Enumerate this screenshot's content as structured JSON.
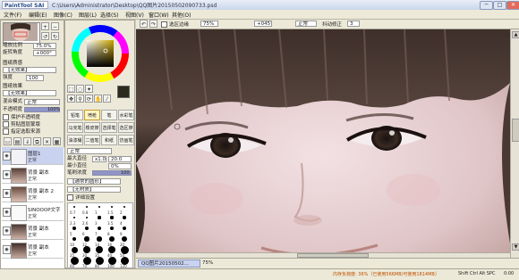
{
  "window": {
    "logo_text": "PaintTool SAI",
    "title": "C:\\Users\\Administrator\\Desktop\\QQ图片20150502090733.psd",
    "buttons": [
      "─",
      "□",
      "✕"
    ]
  },
  "menu": [
    "文件(F)",
    "编辑(E)",
    "图像(C)",
    "图层(L)",
    "选择(S)",
    "视图(V)",
    "窗口(W)",
    "其他(O)"
  ],
  "navigator": {
    "zoom_label": "缩放比例",
    "zoom_value": "75.0%",
    "angle_label": "旋转角度",
    "angle_value": "+000°"
  },
  "layer_props": {
    "effect_header": "图纸质感",
    "effect_value": "【无效果】",
    "strength_label": "强度",
    "strength_value": "100",
    "effect2_header": "图纸效果",
    "effect2_value": "【无效果】",
    "blend_label": "混合模式",
    "blend_value": "正常",
    "opacity_label": "不透明度",
    "opacity_value": "100%",
    "opacity_level": 1.0,
    "checks": [
      "保护不透明度",
      "剪贴图层蒙版",
      "指定选取来源"
    ]
  },
  "layers": [
    {
      "name": "图层1",
      "mode": "正常",
      "opacity": "100%",
      "selected": true
    },
    {
      "name": "背景 副本",
      "mode": "正常",
      "opacity": "100%",
      "selected": false
    },
    {
      "name": "背景 副本 2",
      "mode": "正常",
      "opacity": "100%",
      "selected": false
    },
    {
      "name": "SINOOOP文字",
      "mode": "正常",
      "opacity": "100%",
      "selected": false
    },
    {
      "name": "背景 副本",
      "mode": "正常",
      "opacity": "100%",
      "selected": false
    },
    {
      "name": "背景 副本",
      "mode": "正常",
      "opacity": "100%",
      "selected": false
    }
  ],
  "canvas_toolbar": {
    "antialias_label": "选区边缘",
    "antialias_value": "75%",
    "angle_value": "+045°",
    "mode_value": "正常",
    "stabilizer_label": "抖动修正",
    "stabilizer_value": "3"
  },
  "brushes": {
    "rows": [
      [
        "铅笔",
        "喷枪",
        "笔",
        "水彩笔"
      ],
      [
        "马克笔",
        "橡皮擦",
        "选择笔",
        "选区擦"
      ],
      [
        "油漆桶",
        "二值笔",
        "和纸",
        "仿画笔"
      ]
    ],
    "selected": "喷枪",
    "mode_value": "正常",
    "size_label": "最大直径",
    "size_multiplier": "x1.0",
    "size_value": "20.0",
    "min_size_label": "最小直径",
    "min_size_value": "0%",
    "density_label": "笔刷浓度",
    "density_value": "100",
    "density_level": 1.0,
    "shape_value": "【通常的圆形】",
    "texture_value": "【无材质】",
    "detail_label": "详细设置",
    "sizes": [
      "0.7",
      "0.8",
      "1",
      "1.5",
      "2",
      "2.3",
      "2.6",
      "3",
      "3.5",
      "4",
      "5",
      "6",
      "7",
      "8",
      "9",
      "10",
      "12",
      "14",
      "16",
      "20",
      "25",
      "30",
      "35",
      "40",
      "50",
      "60",
      "70",
      "80",
      "100",
      "120"
    ]
  },
  "canvas": {
    "tab_label": "QQ图片20150502...",
    "zoom_value": "75%"
  },
  "status": {
    "memory_text": "内存负荷度: 36%（已使用566MB/可使用1814MB）",
    "keys": "Shift Ctrl Alt SPC",
    "time": "0:00"
  },
  "colors": {
    "accent": "#3a5ea8",
    "panel": "#ece9d8",
    "selected_layer": "#c9d3f0",
    "status_warning": "#c05000"
  }
}
